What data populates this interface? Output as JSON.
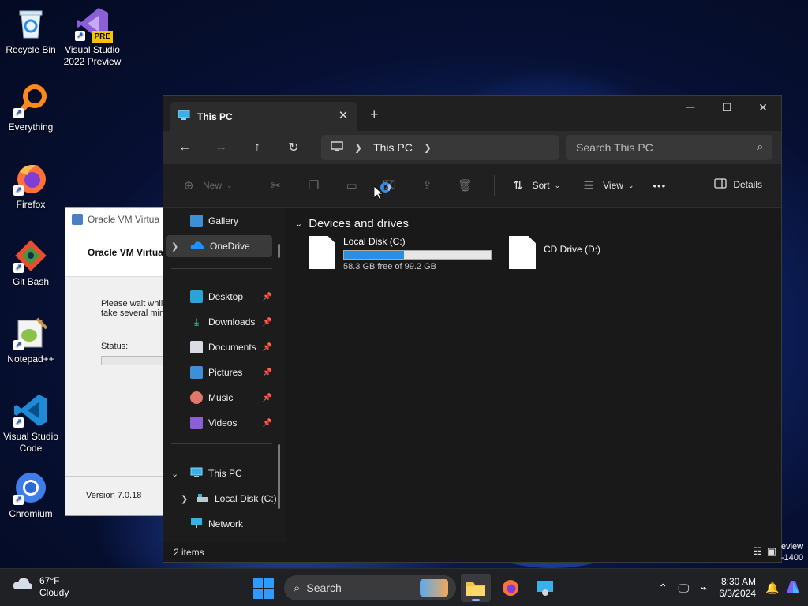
{
  "desktop": {
    "icons": [
      {
        "label": "Recycle Bin"
      },
      {
        "label": "Visual Studio 2022 Preview",
        "badge": "PRE"
      },
      {
        "label": "Everything"
      },
      {
        "label": "Firefox"
      },
      {
        "label": "Git Bash"
      },
      {
        "label": "Notepad++"
      },
      {
        "label": "Visual Studio Code"
      },
      {
        "label": "Chromium"
      }
    ]
  },
  "vbox_window": {
    "title": "Oracle VM Virtua",
    "heading": "Oracle VM Virtua",
    "message": "Please wait whil\ntake several min",
    "status_label": "Status:",
    "version": "Version 7.0.18"
  },
  "explorer": {
    "tab": {
      "label": "This PC",
      "close": "✕",
      "new": "+"
    },
    "window_controls": {
      "minimize": "—",
      "maximize": "☐",
      "close": "✕"
    },
    "nav": {
      "back": "←",
      "forward": "→",
      "up": "↑",
      "refresh": "↻"
    },
    "address": {
      "root_icon": "monitor-icon",
      "crumb": "This PC"
    },
    "search": {
      "placeholder": "Search This PC"
    },
    "commands": {
      "new": "New",
      "sort": "Sort",
      "view": "View",
      "more": "•••",
      "details": "Details"
    },
    "sidebar": {
      "gallery": "Gallery",
      "onedrive": "OneDrive",
      "quick": [
        {
          "label": "Desktop"
        },
        {
          "label": "Downloads"
        },
        {
          "label": "Documents"
        },
        {
          "label": "Pictures"
        },
        {
          "label": "Music"
        },
        {
          "label": "Videos"
        }
      ],
      "this_pc": "This PC",
      "local_disk": "Local Disk (C:)",
      "network": "Network"
    },
    "content": {
      "group_title": "Devices and drives",
      "drives": [
        {
          "name": "Local Disk (C:)",
          "free_text": "58.3 GB free of 99.2 GB",
          "used_fraction": 0.41
        },
        {
          "name": "CD Drive (D:)"
        }
      ]
    },
    "status": {
      "items": "2 items"
    }
  },
  "behind_text": {
    "line1": "eview",
    "line2": "-1400"
  },
  "taskbar": {
    "weather": {
      "temp": "67°F",
      "condition": "Cloudy"
    },
    "search_label": "Search",
    "clock": {
      "time": "8:30 AM",
      "date": "6/3/2024"
    }
  },
  "colors": {
    "accent": "#2f9bff",
    "progress_fill": "#2a8fe0",
    "explorer_bg": "#191919"
  }
}
